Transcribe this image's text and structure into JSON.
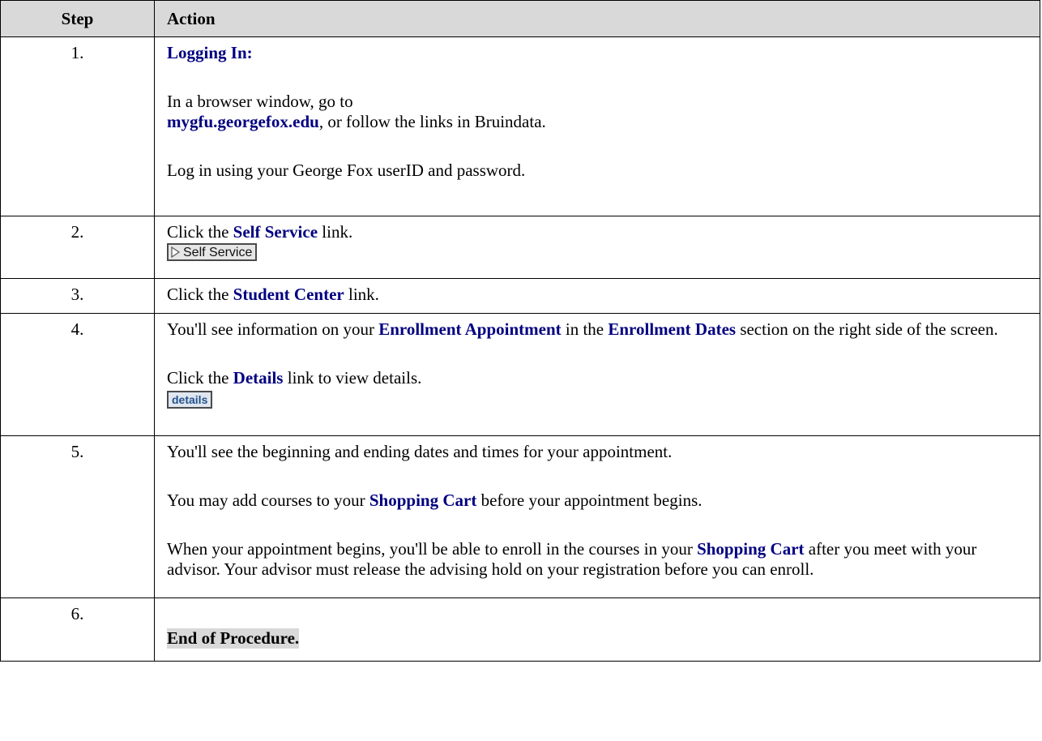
{
  "header": {
    "step": "Step",
    "action": "Action"
  },
  "rows": [
    {
      "num": "1.",
      "title": "Logging In:",
      "p1": "In a browser window, go to",
      "link": "mygfu.georgefox.edu",
      "p1_tail": ", or follow the links in Bruindata.",
      "p2": "Log in using your George Fox userID and password."
    },
    {
      "num": "2.",
      "pre": "Click the ",
      "bold": "Self Service",
      "post": " link.",
      "button_label": "Self Service"
    },
    {
      "num": "3.",
      "pre": "Click the ",
      "bold": "Student Center",
      "post": " link."
    },
    {
      "num": "4.",
      "pre": "You'll see information on your ",
      "bold1": "Enrollment Appointment",
      "mid": " in the ",
      "bold2": "Enrollment Dates",
      "post": " section on the right side of the screen.",
      "p2_pre": "Click the ",
      "p2_bold": "Details",
      "p2_post": " link to view details.",
      "button_label": "details"
    },
    {
      "num": "5.",
      "p1": "You'll see the beginning and ending dates and times for your appointment.",
      "p2_pre": "You may add courses to your ",
      "p2_bold": "Shopping Cart",
      "p2_post": " before your appointment begins.",
      "p3_pre": "When your appointment begins, you'll be able to enroll in the courses in your ",
      "p3_bold": "Shopping Cart",
      "p3_post": " after you meet with your advisor.  Your advisor must release the advising hold on your registration before you can enroll."
    },
    {
      "num": "6.",
      "end": "End of Procedure."
    }
  ]
}
